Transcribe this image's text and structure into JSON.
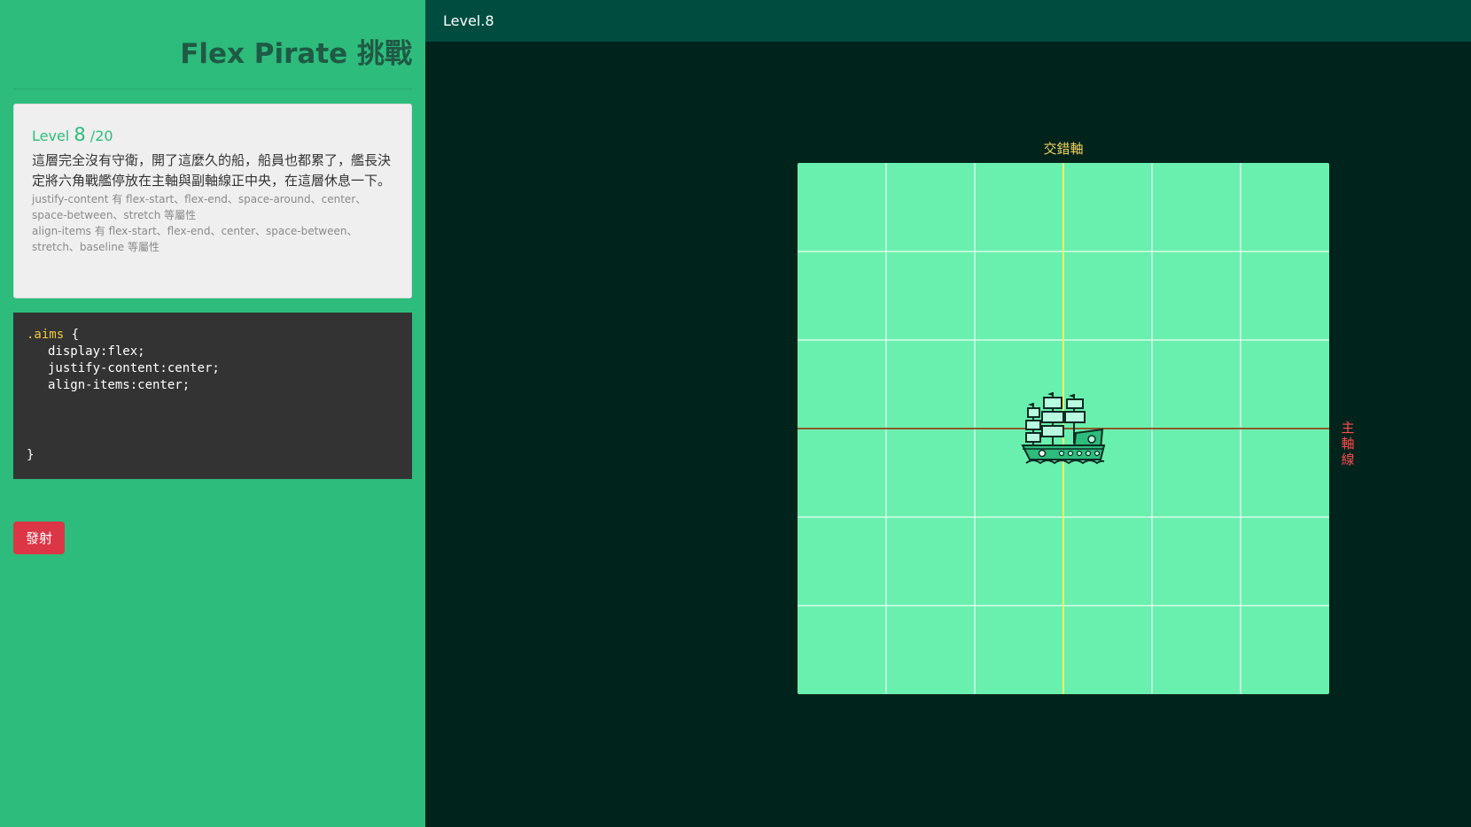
{
  "sidebar": {
    "title": "Flex Pirate 挑戰",
    "level": {
      "prefix": "Level",
      "current": "8",
      "total": "/20"
    },
    "description": "這層完全沒有守衛，開了這麼久的船，船員也都累了，艦長決定將六角戰艦停放在主軸與副軸線正中央，在這層休息一下。",
    "hint_justify": "justify-content 有 flex-start、flex-end、space-around、center、space-between、stretch 等屬性",
    "hint_align": "align-items 有 flex-start、flex-end、center、space-between、stretch、baseline 等屬性",
    "code": {
      "selector": ".aims",
      "open_brace": "{",
      "lines": [
        "display:flex;",
        "justify-content:center;",
        "align-items:center;"
      ],
      "close_brace": "}"
    },
    "fire_button": "發射"
  },
  "header": {
    "level_title": "Level.8"
  },
  "board": {
    "cross_axis_label": "交錯軸",
    "main_axis_label": "主\n軸\n線",
    "ship_icon": "pirate-ship-icon",
    "colors": {
      "sea": "#69f0ae",
      "cross_axis": "#f4f06a",
      "main_axis": "#8b5a2b",
      "main_axis_text": "#ff4d4d",
      "cross_axis_text": "#f4d35e"
    }
  }
}
